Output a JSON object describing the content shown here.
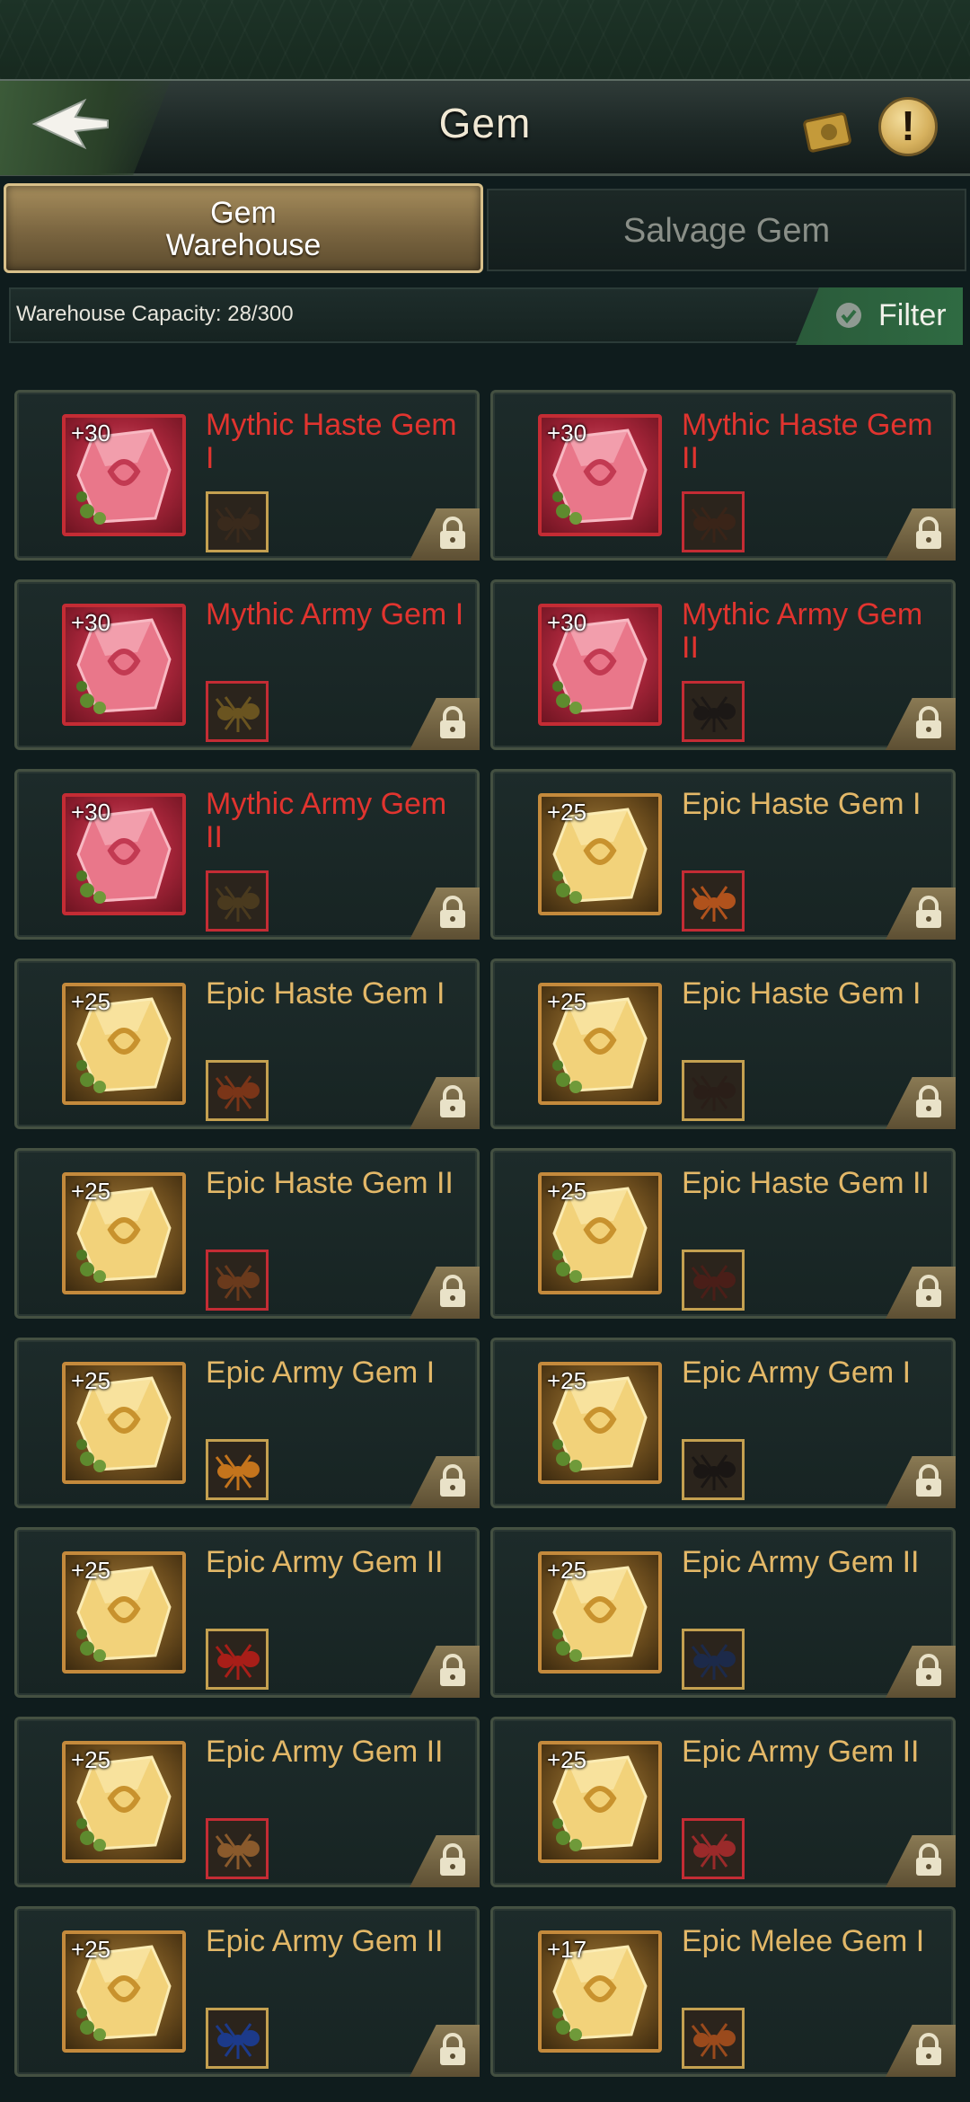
{
  "header": {
    "title": "Gem"
  },
  "tabs": [
    {
      "label_line1": "Gem",
      "label_line2": "Warehouse",
      "active": true
    },
    {
      "label": "Salvage Gem",
      "active": false
    }
  ],
  "capacity": {
    "text": "Warehouse Capacity: 28/300"
  },
  "filter": {
    "label": "Filter"
  },
  "gems": [
    {
      "name": "Mythic Haste Gem I",
      "level": "+30",
      "rarity": "mythic",
      "ant_color": "#3a2a1c",
      "slot_border": "#c4a050"
    },
    {
      "name": "Mythic Haste Gem II",
      "level": "+30",
      "rarity": "mythic",
      "ant_color": "#3a2418",
      "slot_border": "#c42c34"
    },
    {
      "name": "Mythic Army Gem I",
      "level": "+30",
      "rarity": "mythic",
      "ant_color": "#6a5420",
      "slot_border": "#c42c34"
    },
    {
      "name": "Mythic Army Gem II",
      "level": "+30",
      "rarity": "mythic",
      "ant_color": "#1c1816",
      "slot_border": "#c42c34"
    },
    {
      "name": "Mythic Army Gem II",
      "level": "+30",
      "rarity": "mythic",
      "ant_color": "#4a3a1e",
      "slot_border": "#c42c34"
    },
    {
      "name": "Epic Haste Gem I",
      "level": "+25",
      "rarity": "epic",
      "ant_color": "#b0521c",
      "slot_border": "#c42c34"
    },
    {
      "name": "Epic Haste Gem I",
      "level": "+25",
      "rarity": "epic",
      "ant_color": "#7a3518",
      "slot_border": "#c4a050"
    },
    {
      "name": "Epic Haste Gem I",
      "level": "+25",
      "rarity": "epic",
      "ant_color": "#2a1e18",
      "slot_border": "#c4a050"
    },
    {
      "name": "Epic Haste Gem II",
      "level": "+25",
      "rarity": "epic",
      "ant_color": "#6a3a1c",
      "slot_border": "#c42c34"
    },
    {
      "name": "Epic Haste Gem II",
      "level": "+25",
      "rarity": "epic",
      "ant_color": "#4a1e18",
      "slot_border": "#c4a050"
    },
    {
      "name": "Epic Army Gem I",
      "level": "+25",
      "rarity": "epic",
      "ant_color": "#c4741c",
      "slot_border": "#c4a050"
    },
    {
      "name": "Epic Army Gem I",
      "level": "+25",
      "rarity": "epic",
      "ant_color": "#1a1614",
      "slot_border": "#c4a050"
    },
    {
      "name": "Epic Army Gem II",
      "level": "+25",
      "rarity": "epic",
      "ant_color": "#a81e18",
      "slot_border": "#c4a050"
    },
    {
      "name": "Epic Army Gem II",
      "level": "+25",
      "rarity": "epic",
      "ant_color": "#1c2a4a",
      "slot_border": "#c4a050"
    },
    {
      "name": "Epic Army Gem II",
      "level": "+25",
      "rarity": "epic",
      "ant_color": "#8a5a2c",
      "slot_border": "#c42c34"
    },
    {
      "name": "Epic Army Gem II",
      "level": "+25",
      "rarity": "epic",
      "ant_color": "#9a2a2a",
      "slot_border": "#c42c34"
    },
    {
      "name": "Epic Army Gem II",
      "level": "+25",
      "rarity": "epic",
      "ant_color": "#1c3a8a",
      "slot_border": "#c4a050"
    },
    {
      "name": "Epic Melee Gem I",
      "level": "+17",
      "rarity": "epic",
      "ant_color": "#9a4a1c",
      "slot_border": "#c4a050"
    }
  ]
}
